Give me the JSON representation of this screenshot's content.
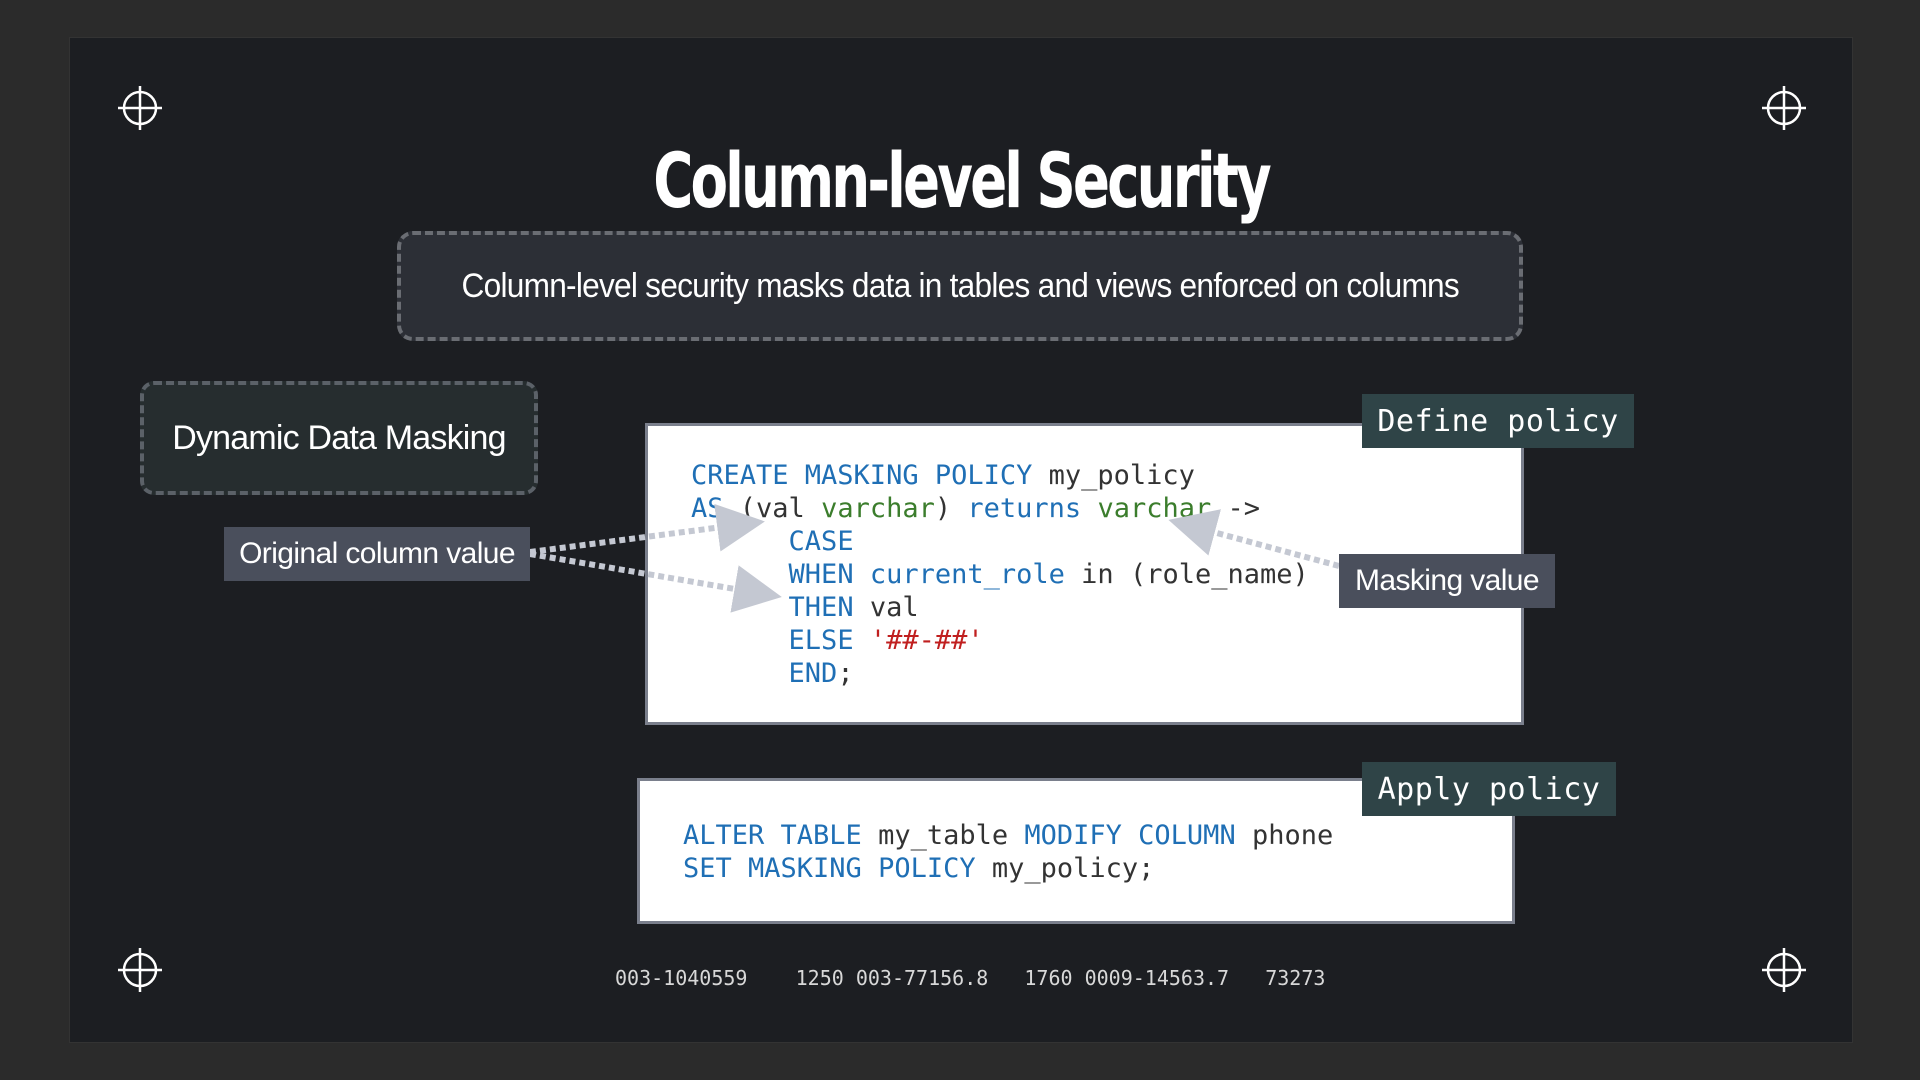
{
  "slide": {
    "title": "Column-level Security",
    "subtitle": "Column-level security masks data in tables and views enforced on columns",
    "feature_box": "Dynamic Data Masking",
    "labels": {
      "original": "Original column value",
      "masking": "Masking value"
    },
    "define": {
      "tag": "Define policy",
      "code": {
        "l1_kw": "CREATE MASKING POLICY",
        "l1_tx": " my_policy",
        "l2_kw1": "AS",
        "l2_tx1": " (val ",
        "l2_ty1": "varchar",
        "l2_tx2": ") ",
        "l2_kw2": "returns",
        "l2_tx3": " ",
        "l2_ty2": "varchar",
        "l2_tx4": " ->",
        "l3_kw": "CASE",
        "l4_kw": "WHEN",
        "l4_tx1": " ",
        "l4_fn": "current_role",
        "l4_tx2": " in (role_name)",
        "l5_kw": "THEN",
        "l5_tx": " val",
        "l6_kw": "ELSE",
        "l6_tx": " ",
        "l6_str": "'##-##'",
        "l7_kw": "END",
        "l7_tx": ";"
      }
    },
    "apply": {
      "tag": "Apply policy",
      "code": {
        "l1_kw1": "ALTER TABLE",
        "l1_tx1": " my_table ",
        "l1_kw2": "MODIFY COLUMN",
        "l1_tx2": " phone",
        "l2_kw": "SET MASKING POLICY",
        "l2_tx": " my_policy;"
      }
    },
    "footer_numbers": "003-1040559    1250 003-77156.8   1760 0009-14563.7   73273"
  },
  "colors": {
    "background": "#1c1e22",
    "keyword": "#1f6fb5",
    "type": "#3b7d2c",
    "string": "#c01f1f",
    "tag_bg": "#2f4447",
    "label_bg": "#4a4f5c"
  }
}
